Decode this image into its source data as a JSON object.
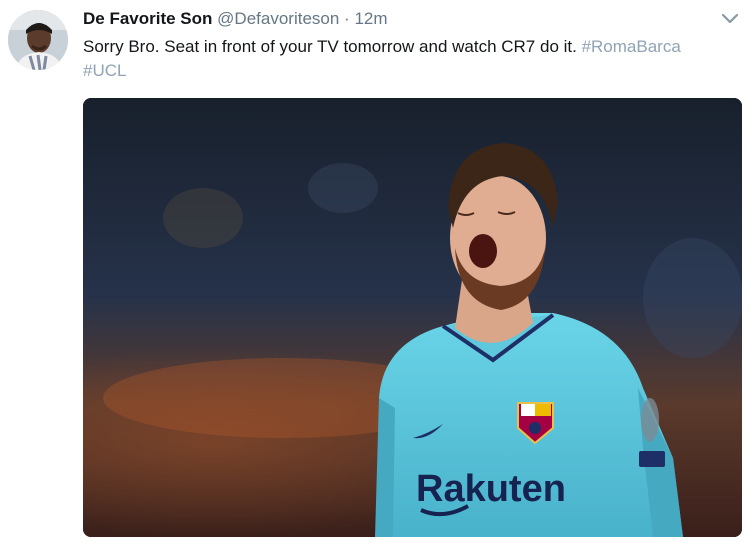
{
  "tweet": {
    "display_name": "De Favorite Son",
    "handle": "@Defavoriteson",
    "separator": "·",
    "time": "12m",
    "text_prefix": "Sorry Bro. Seat in front of your TV tomorrow and watch CR7 do it.",
    "hashtags": [
      "#RomaBarca",
      "#UCL"
    ]
  },
  "media": {
    "sponsor_text": "Rakuten",
    "icon": "photo-of-footballer"
  },
  "colors": {
    "link": "#1da1f2",
    "meta": "#657786",
    "jersey": "#5fc8dd"
  }
}
